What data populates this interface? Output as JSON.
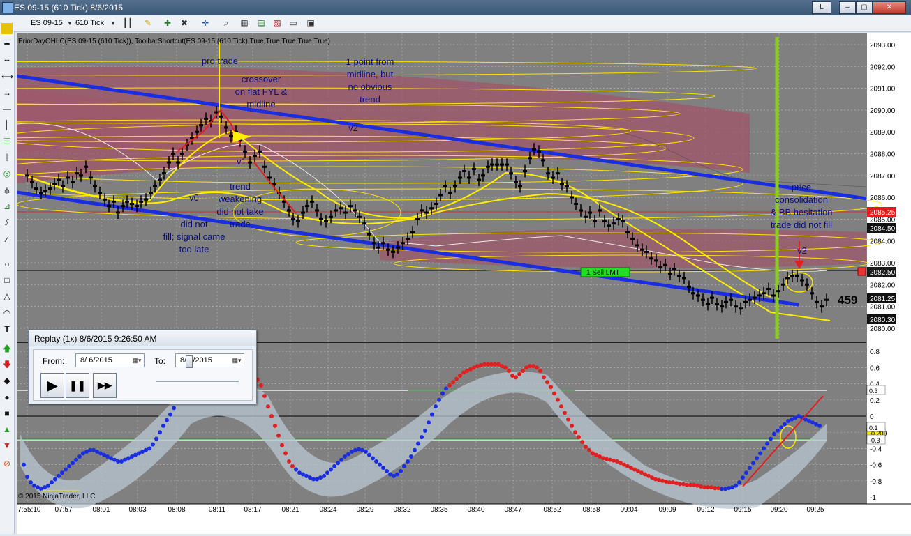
{
  "window": {
    "title": "ES 09-15 (610 Tick)  8/6/2015",
    "btn_letter": "L"
  },
  "toolbar": {
    "instrument": "ES 09-15",
    "interval": "610 Tick"
  },
  "chart": {
    "indicator_label": "PriorDayOHLC(ES 09-15 (610 Tick)), ToolbarShortcut(ES 09-15 (610 Tick),True,True,True,True,True)",
    "copyright": "© 2015 NinjaTrader, LLC",
    "order_label": "1  Sell LMT",
    "tick_count": "459",
    "price_axis": [
      "2093.00",
      "2092.00",
      "2091.00",
      "2090.00",
      "2089.00",
      "2088.00",
      "2087.00",
      "2086.00",
      "2085.00",
      "2084.00",
      "2083.00",
      "2082.00",
      "2081.00",
      "2080.00"
    ],
    "price_badges": [
      {
        "text": "2085.25",
        "color": "#e02020"
      },
      {
        "text": "2084.50",
        "color": "#111111"
      },
      {
        "text": "2082.50",
        "color": "#1a1a1a"
      },
      {
        "text": "2081.25",
        "color": "#111111"
      },
      {
        "text": "2080.30",
        "color": "#111111"
      }
    ],
    "osc_axis": [
      "0.8",
      "0.6",
      "0.4",
      "0.2",
      "0",
      "-0.2",
      "-0.4",
      "-0.6",
      "-0.8",
      "-1"
    ],
    "osc_badges": [
      "0.3",
      "-0.209",
      "-0.3",
      "0.1"
    ],
    "time_axis": [
      "07:55:10",
      "07:57",
      "08:01",
      "08:03",
      "08:08",
      "08:11",
      "08:17",
      "08:21",
      "08:24",
      "08:29",
      "08:32",
      "08:35",
      "08:40",
      "08:47",
      "08:52",
      "08:58",
      "09:04",
      "09:09",
      "09:12",
      "09:15",
      "09:20",
      "09:25"
    ],
    "annotations": [
      {
        "id": "pro-trade",
        "text": "pro trade"
      },
      {
        "id": "crossover",
        "text": "crossover\non flat FYL &\nmidline"
      },
      {
        "id": "one-point",
        "text": "1 point from\nmidline, but\nno obvious\ntrend"
      },
      {
        "id": "v2-top",
        "text": "v2"
      },
      {
        "id": "v1",
        "text": "v1"
      },
      {
        "id": "v0",
        "text": "v0"
      },
      {
        "id": "trend-weakening",
        "text": "trend\nweakening\ndid not take\ntrade"
      },
      {
        "id": "did-not-fill",
        "text": "did not\nfill; signal came\ntoo late"
      },
      {
        "id": "price-consolidation",
        "text": "price\nconsolidation\n& BB hesitation\ntrade did not fill"
      },
      {
        "id": "v2-right",
        "text": "v2"
      }
    ],
    "colors": {
      "background": "#808080",
      "trendline": "#1a2ee0",
      "annotation_text": "#0a0f80",
      "band_fill": "#a0566a",
      "ellipse": "#ffe400"
    }
  },
  "replay": {
    "title": "Replay (1x)  8/6/2015 9:26:50 AM",
    "from_label": "From:",
    "from_value": "8/  6/2015",
    "to_label": "To:",
    "to_value": "8/  7/2015",
    "play": "▶",
    "pause": "❚❚",
    "fast": "▶▶"
  }
}
